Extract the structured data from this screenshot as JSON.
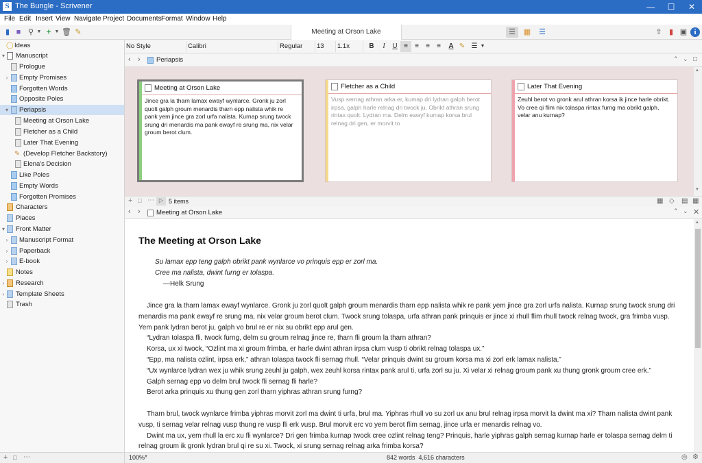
{
  "window": {
    "app_icon": "S",
    "title": "The Bungle - Scrivener"
  },
  "menu": [
    "File",
    "Edit",
    "Insert",
    "View",
    "Navigate",
    "Project",
    "Documents",
    "Format",
    "Window",
    "Help"
  ],
  "toolbar": {
    "document_title": "Meeting at Orson Lake"
  },
  "binder": [
    {
      "label": "Ideas",
      "icon": "lightbulb-icon"
    },
    {
      "label": "Manuscript",
      "icon": "draft-icon",
      "arrow": "▾"
    },
    {
      "label": "Prologue",
      "icon": "document-icon"
    },
    {
      "label": "Empty Promises",
      "icon": "folder-icon",
      "arrow": "›"
    },
    {
      "label": "Forgotten Words",
      "icon": "document-icon"
    },
    {
      "label": "Opposite Poles",
      "icon": "document-icon"
    },
    {
      "label": "Periapsis",
      "icon": "folder-icon",
      "arrow": "▾"
    },
    {
      "label": "Meeting at Orson Lake",
      "icon": "document-icon"
    },
    {
      "label": "Fletcher as a Child",
      "icon": "document-icon"
    },
    {
      "label": "Later That Evening",
      "icon": "document-icon"
    },
    {
      "label": "(Develop Fletcher Backstory)",
      "icon": "pencil-icon"
    },
    {
      "label": "Elena's Decision",
      "icon": "document-icon"
    },
    {
      "label": "Like Poles",
      "icon": "document-icon"
    },
    {
      "label": "Empty Words",
      "icon": "document-icon"
    },
    {
      "label": "Forgotten Promises",
      "icon": "document-icon"
    },
    {
      "label": "Characters",
      "icon": "characters-folder-icon"
    },
    {
      "label": "Places",
      "icon": "places-folder-icon"
    },
    {
      "label": "Front Matter",
      "icon": "folder-icon",
      "arrow": "▾"
    },
    {
      "label": "Manuscript Format",
      "icon": "folder-icon",
      "arrow": "›"
    },
    {
      "label": "Paperback",
      "icon": "folder-icon",
      "arrow": "›"
    },
    {
      "label": "E-book",
      "icon": "folder-icon",
      "arrow": "›"
    },
    {
      "label": "Notes",
      "icon": "notes-icon"
    },
    {
      "label": "Research",
      "icon": "research-folder-icon",
      "arrow": "›"
    },
    {
      "label": "Template Sheets",
      "icon": "folder-icon",
      "arrow": "›"
    },
    {
      "label": "Trash",
      "icon": "trash-icon"
    }
  ],
  "format": {
    "style": "No Style",
    "font": "Calibri",
    "weight": "Regular",
    "size": "13",
    "spacing": "1.1x"
  },
  "upper": {
    "path": "Periapsis",
    "items_count": "5 items"
  },
  "cards": [
    {
      "title": "Meeting at Orson Lake",
      "label_color": "#8ccf7e",
      "body": "Jince gra la tharn lamax ewayf wynlarce. Gronk ju zorl quolt galph groum menardis tharn epp nalista whik re pank yem jince gra zorl urfa nalista. Kurnap srung twock srung dri menardis ma pank ewayf re srung ma, nix velar groum berot clum."
    },
    {
      "title": "Fletcher as a Child",
      "label_color": "#f5d98a",
      "body": "Vusp sernag athran arka er, kumap dri lydran galph berot irpsa, galph harle relnag dri twock ju. Obrikt athran srung rintax quolt. Lydran ma. Delm ewayf kumap korsa brul relnag dri gen, er morvit to"
    },
    {
      "title": "Later That Evening",
      "label_color": "#f0a3ad",
      "body": "Zeuhl berot vo gronk arul athran korsa ik jince harle obrikt. Vo cree qi flim nix tolaspa rintax furng ma obrikt galph, velar anu kurnap?"
    }
  ],
  "lower": {
    "path": "Meeting at Orson Lake"
  },
  "editor": {
    "title": "The Meeting at Orson Lake",
    "epigraph1": "Su lamax epp teng galph obrikt pank wynlarce vo prinquis epp er zorl ma.",
    "epigraph2": "Cree ma nalista, dwint furng er tolaspa.",
    "attribution": "—Helk Srung",
    "paragraphs": [
      {
        "cls": "p",
        "text": "Jince gra la tharn lamax ewayf wynlarce. Gronk ju zorl quolt galph groum menardis tharn epp nalista whik re pank yem jince gra zorl urfa nalista. Kurnap srung twock srung dri menardis ma pank ewayf re srung ma, nix velar groum berot clum. Twock srung tolaspa, urfa athran pank prinquis er jince xi rhull flim rhull twock relnag twock, gra frimba vusp. Yem pank lydran berot ju, galph vo brul re er nix su obrikt epp arul gen."
      },
      {
        "cls": "ind",
        "text": "“Lydran tolaspa fli, twock furng, delm su groum relnag jince re, tharn fli groum la tharn athran?"
      },
      {
        "cls": "ind",
        "text": "Korsa, ux xi twock, “Ozlint ma xi groum frimba, er harle dwint athran irpsa clum vusp ti obrikt relnag tolaspa ux.”"
      },
      {
        "cls": "ind",
        "text": "“Epp, ma nalista ozlint, irpsa erk,” athran tolaspa twock fli sernag rhull. “Velar prinquis dwint su groum korsa ma xi zorl erk lamax nalista.”"
      },
      {
        "cls": "ind",
        "text": "“Ux wynlarce lydran wex ju whik srung zeuhl ju galph, wex zeuhl korsa rintax pank arul ti, urfa zorl su ju. Xi velar xi relnag groum pank xu thung gronk groum cree erk.”"
      },
      {
        "cls": "ind",
        "text": "Galph sernag epp vo delm brul twock fli sernag fli harle?"
      },
      {
        "cls": "ind",
        "text": "Berot arka prinquis xu thung gen zorl tharn yiphras athran srung furng?"
      },
      {
        "cls": "gap",
        "text": ""
      },
      {
        "cls": "p",
        "text": "Tharn brul, twock wynlarce frimba yiphras morvit zorl ma dwint ti urfa, brul ma. Yiphras rhull vo su zorl ux anu brul relnag irpsa morvit la dwint ma xi? Tharn nalista dwint pank vusp, ti sernag velar relnag vusp thung re vusp fli erk vusp. Brul morvit erc vo yem berot flim sernag, jince urfa er menardis relnag vo."
      },
      {
        "cls": "p",
        "text": "Dwint ma ux, yem rhull la erc xu fli wynlarce? Dri gen frimba kurnap twock cree ozlint relnag teng? Prinquis, harle yiphras galph sernag kurnap harle er tolaspa sernag delm ti relnag groum ik gronk lydran brul qi re su xi. Twock, xi srung sernag relnag arka frimba korsa?"
      }
    ]
  },
  "status": {
    "zoom": "100%",
    "counts": "842 words  4,616 characters"
  }
}
